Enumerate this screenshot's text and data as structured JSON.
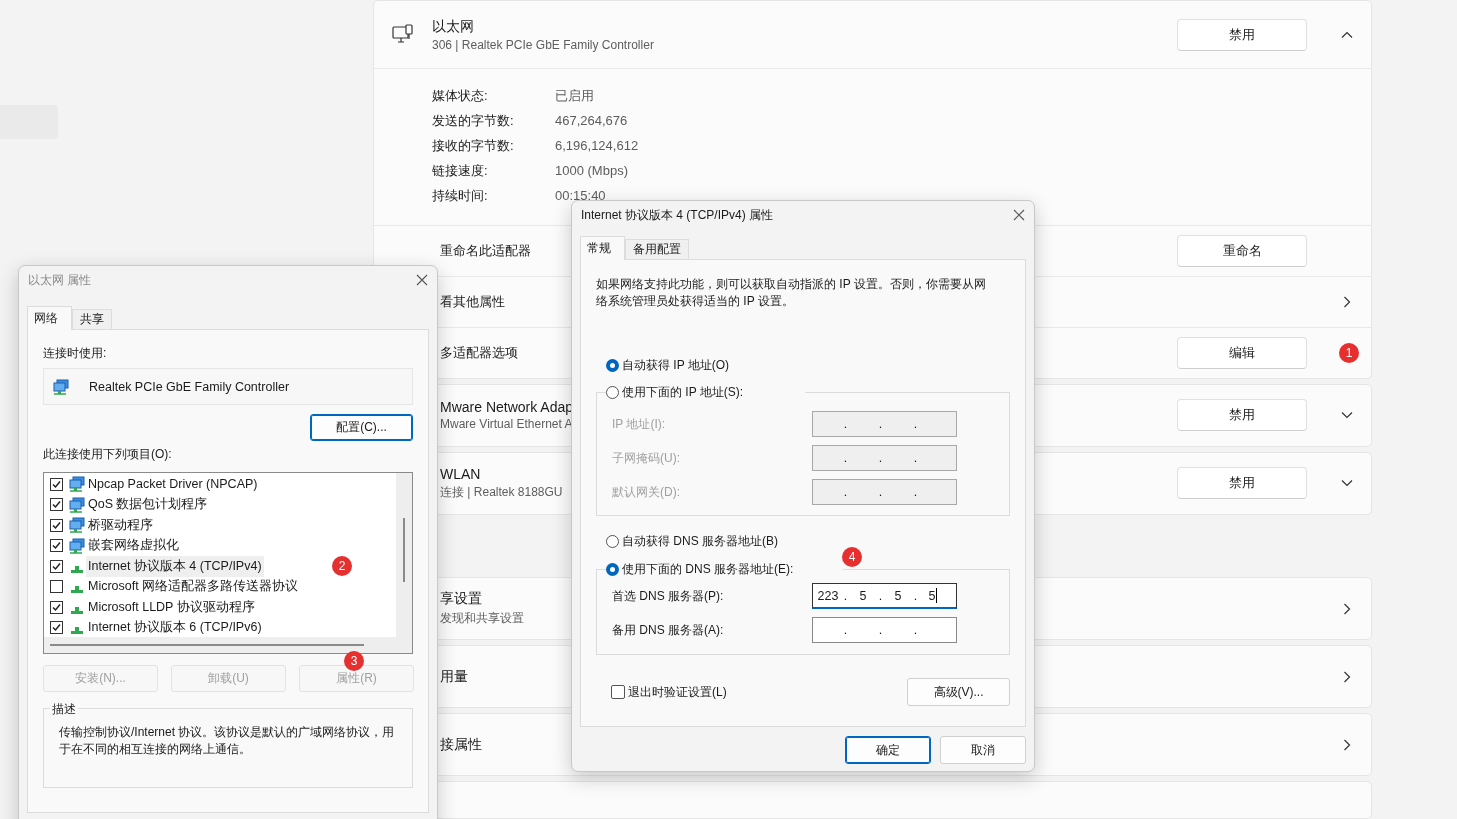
{
  "settings": {
    "adapter": {
      "title": "以太网",
      "subtitle": "306 | Realtek PCIe GbE Family Controller",
      "button": "禁用",
      "expanded": true,
      "details": [
        {
          "label": "媒体状态:",
          "value": "已启用"
        },
        {
          "label": "发送的字节数:",
          "value": "467,264,676"
        },
        {
          "label": "接收的字节数:",
          "value": "6,196,124,612"
        },
        {
          "label": "链接速度:",
          "value": "1000 (Mbps)"
        },
        {
          "label": "持续时间:",
          "value": "00:15:40"
        }
      ],
      "actions": [
        {
          "kind": "button",
          "label": "重命名此适配器",
          "button": "重命名"
        },
        {
          "kind": "link",
          "label": "看其他属性"
        },
        {
          "kind": "button",
          "label": "多适配器选项",
          "button": "编辑",
          "badge": "1"
        }
      ]
    },
    "other_adapters": [
      {
        "title": "Mware Network Adap",
        "subtitle": "Mware Virtual Ethernet A",
        "button": "禁用",
        "expanded": false
      },
      {
        "title": "WLAN",
        "subtitle": "连接 | Realtek 8188GU",
        "button": "禁用",
        "expanded": false
      }
    ],
    "more": [
      {
        "title": "享设置",
        "subtitle": "发现和共享设置"
      },
      {
        "title": "用量"
      },
      {
        "title": "接属性"
      }
    ]
  },
  "ethernet_properties": {
    "title": "以太网 属性",
    "active": false,
    "tabs": [
      {
        "label": "网络",
        "selected": true
      },
      {
        "label": "共享",
        "selected": false
      }
    ],
    "connect_using_label": "连接时使用:",
    "adapter_name": "Realtek PCIe GbE Family Controller",
    "configure_button": {
      "label": "配置(C)...",
      "focused": true
    },
    "items_label": "此连接使用下列项目(O):",
    "items": [
      {
        "kind": "adapter",
        "label": "Npcap Packet Driver (NPCAP)",
        "checked": true,
        "selected": false
      },
      {
        "kind": "adapter",
        "label": "QoS 数据包计划程序",
        "checked": true,
        "selected": false
      },
      {
        "kind": "adapter",
        "label": "桥驱动程序",
        "checked": true,
        "selected": false
      },
      {
        "kind": "adapter",
        "label": "嵌套网络虚拟化",
        "checked": true,
        "selected": false
      },
      {
        "kind": "protocol",
        "label": "Internet 协议版本 4 (TCP/IPv4)",
        "checked": true,
        "selected": true,
        "badge": "2"
      },
      {
        "kind": "protocol",
        "label": "Microsoft 网络适配器多路传送器协议",
        "checked": false,
        "selected": false
      },
      {
        "kind": "protocol",
        "label": "Microsoft LLDP 协议驱动程序",
        "checked": true,
        "selected": false
      },
      {
        "kind": "protocol",
        "label": "Internet 协议版本 6 (TCP/IPv6)",
        "checked": true,
        "selected": false
      }
    ],
    "item_buttons": [
      {
        "label": "安装(N)...",
        "disabled": true
      },
      {
        "label": "卸载(U)",
        "disabled": true
      },
      {
        "label": "属性(R)",
        "disabled": true,
        "badge": "3"
      }
    ],
    "description": {
      "legend": "描述",
      "text": "传输控制协议/Internet 协议。该协议是默认的广域网络协议，用于在不同的相互连接的网络上通信。"
    }
  },
  "ipv4_properties": {
    "title": "Internet 协议版本 4 (TCP/IPv4) 属性",
    "active": true,
    "tabs": [
      {
        "label": "常规",
        "selected": true
      },
      {
        "label": "备用配置",
        "selected": false
      }
    ],
    "intro": "如果网络支持此功能，则可以获取自动指派的 IP 设置。否则，你需要从网络系统管理员处获得适当的 IP 设置。",
    "ip_mode": [
      {
        "label": "自动获得 IP 地址(O)",
        "selected": true
      },
      {
        "label": "使用下面的 IP 地址(S):",
        "selected": false
      }
    ],
    "ip_fields": [
      {
        "label": "IP 地址(I):",
        "disabled": true,
        "separators": [
          ".",
          ".",
          "."
        ]
      },
      {
        "label": "子网掩码(U):",
        "disabled": true,
        "separators": [
          ".",
          ".",
          "."
        ]
      },
      {
        "label": "默认网关(D):",
        "disabled": true,
        "separators": [
          ".",
          ".",
          "."
        ]
      }
    ],
    "dns_mode": [
      {
        "label": "自动获得 DNS 服务器地址(B)",
        "selected": false
      },
      {
        "label": "使用下面的 DNS 服务器地址(E):",
        "selected": true,
        "badge": "4"
      }
    ],
    "dns_fields": [
      {
        "label": "首选 DNS 服务器(P):",
        "disabled": false,
        "focused": true,
        "octets": [
          "223",
          "5",
          "5",
          "5"
        ],
        "separators": [
          ".",
          ".",
          "."
        ]
      },
      {
        "label": "备用 DNS 服务器(A):",
        "disabled": false,
        "focused": false,
        "separators": [
          ".",
          ".",
          "."
        ]
      }
    ],
    "validate": {
      "label": "退出时验证设置(L)",
      "checked": false
    },
    "advanced_button": "高级(V)...",
    "buttons": [
      {
        "label": "确定",
        "default": true
      },
      {
        "label": "取消",
        "default": false
      }
    ]
  }
}
